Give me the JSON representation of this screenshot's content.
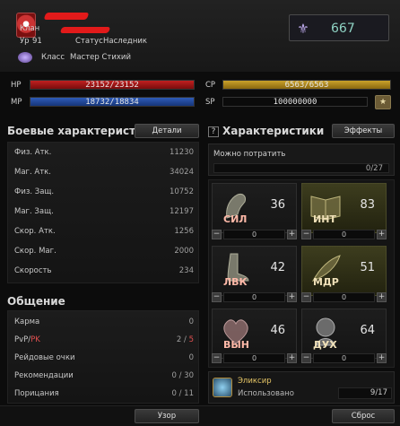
{
  "header": {
    "clan_label": "Клан",
    "level_label": "Ур",
    "level_value": "91",
    "status_label": "Статус",
    "status_value": "Наследник",
    "class_label": "Класс",
    "class_value": "Мастер Стихий",
    "points_value": "667"
  },
  "bars": {
    "hp": {
      "label": "HP",
      "text": "23152/23152",
      "fraction": 1.0
    },
    "mp": {
      "label": "MP",
      "text": "18732/18834",
      "fraction": 0.995
    },
    "cp": {
      "label": "CP",
      "text": "6563/6563",
      "fraction": 1.0
    },
    "sp": {
      "label": "SP",
      "text": "100000000"
    }
  },
  "combat": {
    "title": "Боевые характеристики",
    "details_button": "Детали",
    "stats": [
      {
        "name": "Физ. Атк.",
        "value": "11230"
      },
      {
        "name": "Маг. Атк.",
        "value": "34024"
      },
      {
        "name": "Физ. Защ.",
        "value": "10752"
      },
      {
        "name": "Маг. Защ.",
        "value": "12197"
      },
      {
        "name": "Скор. Атк.",
        "value": "1256"
      },
      {
        "name": "Скор. Маг.",
        "value": "2000"
      },
      {
        "name": "Скорость",
        "value": "234"
      }
    ]
  },
  "social": {
    "title": "Общение",
    "rows": [
      {
        "name": "Карма",
        "value": "0"
      },
      {
        "name_a": "PvP",
        "name_sep": "/",
        "name_b": "PK",
        "value_a": "2",
        "value_sep": " / ",
        "value_b": "5"
      },
      {
        "name": "Рейдовые очки",
        "value": "0"
      },
      {
        "name": "Рекомендации",
        "value": "0 / 30"
      },
      {
        "name": "Порицания",
        "value": "0 / 11"
      }
    ]
  },
  "attributes": {
    "title": "Характеристики",
    "effects_button": "Эффекты",
    "spendable_label": "Можно потратить",
    "spendable_value": "0/27",
    "tiles": [
      {
        "name": "СИЛ",
        "value": "36",
        "alloc": "0",
        "icon": "arm-icon",
        "lit": false
      },
      {
        "name": "ИНТ",
        "value": "83",
        "alloc": "0",
        "icon": "book-icon",
        "lit": true
      },
      {
        "name": "ЛВК",
        "value": "42",
        "alloc": "0",
        "icon": "foot-icon",
        "lit": false
      },
      {
        "name": "МДР",
        "value": "51",
        "alloc": "0",
        "icon": "feather-icon",
        "lit": true
      },
      {
        "name": "ВЫН",
        "value": "46",
        "alloc": "0",
        "icon": "heart-icon",
        "lit": false
      },
      {
        "name": "ДУХ",
        "value": "64",
        "alloc": "0",
        "icon": "head-icon",
        "lit": false
      }
    ],
    "elixir_label": "Эликсир",
    "elixir_used_label": "Использовано",
    "elixir_used_value": "9/17"
  },
  "footer": {
    "pattern_button": "Узор",
    "reset_button": "Сброс"
  },
  "colors": {
    "hp": "#c02020",
    "mp": "#2e5bb8",
    "cp": "#c9a12a",
    "pk": "#e05050"
  }
}
